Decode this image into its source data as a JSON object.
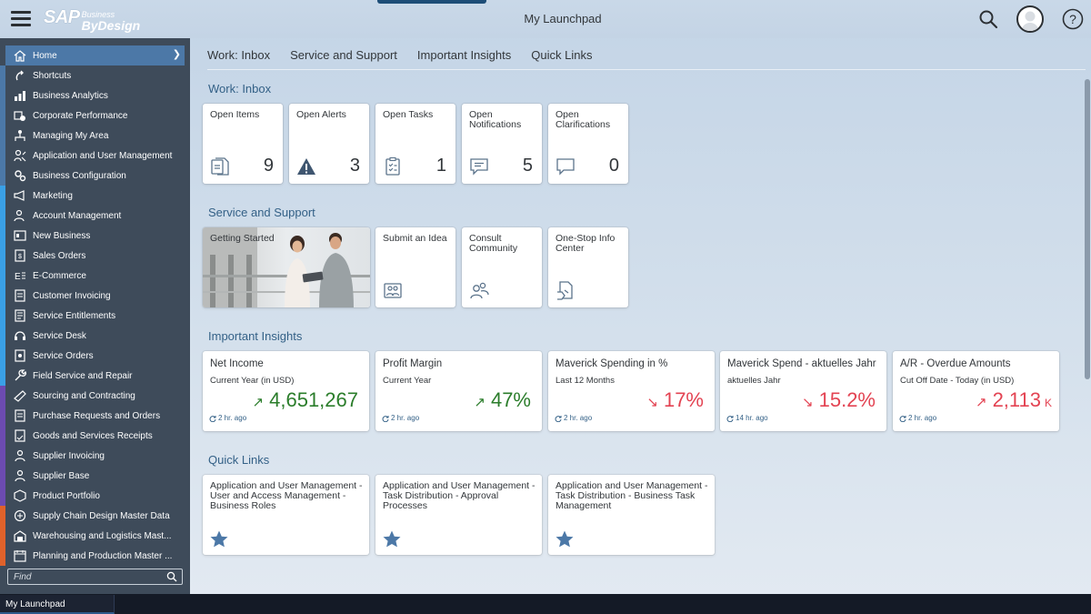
{
  "shell": {
    "brand": "SAP",
    "brand_sub_top": "Business",
    "brand_sub_bottom": "ByDesign",
    "title": "My Launchpad"
  },
  "sidebar": {
    "items": [
      {
        "label": "Home",
        "icon": "home-icon",
        "bar": "#4c78a7",
        "active": true
      },
      {
        "label": "Shortcuts",
        "icon": "shortcut-icon",
        "bar": "#4c78a7"
      },
      {
        "label": "Business Analytics",
        "icon": "bar-chart-icon",
        "bar": "#4c78a7"
      },
      {
        "label": "Corporate Performance",
        "icon": "performance-icon",
        "bar": "#4c78a7"
      },
      {
        "label": "Managing My Area",
        "icon": "org-icon",
        "bar": "#4c78a7"
      },
      {
        "label": "Application and User Management",
        "icon": "user-settings-icon",
        "bar": "#4c78a7"
      },
      {
        "label": "Business Configuration",
        "icon": "gears-icon",
        "bar": "#4c78a7"
      },
      {
        "label": "Marketing",
        "icon": "megaphone-icon",
        "bar": "#3aa0e6"
      },
      {
        "label": "Account Management",
        "icon": "account-icon",
        "bar": "#3aa0e6"
      },
      {
        "label": "New Business",
        "icon": "new-business-icon",
        "bar": "#3aa0e6"
      },
      {
        "label": "Sales Orders",
        "icon": "sales-order-icon",
        "bar": "#3aa0e6"
      },
      {
        "label": "E-Commerce",
        "icon": "ecommerce-icon",
        "bar": "#3aa0e6"
      },
      {
        "label": "Customer Invoicing",
        "icon": "invoice-icon",
        "bar": "#3aa0e6"
      },
      {
        "label": "Service Entitlements",
        "icon": "entitlement-icon",
        "bar": "#3aa0e6"
      },
      {
        "label": "Service Desk",
        "icon": "headset-icon",
        "bar": "#3aa0e6"
      },
      {
        "label": "Service Orders",
        "icon": "service-order-icon",
        "bar": "#3aa0e6"
      },
      {
        "label": "Field Service and Repair",
        "icon": "wrench-icon",
        "bar": "#3aa0e6"
      },
      {
        "label": "Sourcing and Contracting",
        "icon": "sourcing-icon",
        "bar": "#6c4bb1"
      },
      {
        "label": "Purchase Requests and Orders",
        "icon": "cart-icon",
        "bar": "#6c4bb1"
      },
      {
        "label": "Goods and Services Receipts",
        "icon": "receipt-icon",
        "bar": "#6c4bb1"
      },
      {
        "label": "Supplier Invoicing",
        "icon": "supplier-invoice-icon",
        "bar": "#6c4bb1"
      },
      {
        "label": "Supplier Base",
        "icon": "supplier-icon",
        "bar": "#6c4bb1"
      },
      {
        "label": "Product Portfolio",
        "icon": "product-icon",
        "bar": "#6c4bb1"
      },
      {
        "label": "Supply Chain Design Master Data",
        "icon": "supply-chain-icon",
        "bar": "#e0622b"
      },
      {
        "label": "Warehousing and Logistics Mast...",
        "icon": "warehouse-icon",
        "bar": "#e0622b"
      },
      {
        "label": "Planning and Production Master ...",
        "icon": "planning-icon",
        "bar": "#e0622b"
      }
    ],
    "find_placeholder": "Find"
  },
  "anchors": [
    "Work: Inbox",
    "Service and Support",
    "Important Insights",
    "Quick Links"
  ],
  "sections": {
    "inbox": {
      "title": "Work: Inbox",
      "tiles": [
        {
          "title": "Open Items",
          "count": "9",
          "icon": "document-icon"
        },
        {
          "title": "Open Alerts",
          "count": "3",
          "icon": "alert-icon"
        },
        {
          "title": "Open Tasks",
          "count": "1",
          "icon": "task-icon"
        },
        {
          "title": "Open Notifications",
          "count": "5",
          "icon": "notification-icon"
        },
        {
          "title": "Open Clarifications",
          "count": "0",
          "icon": "clarification-icon"
        }
      ]
    },
    "service": {
      "title": "Service and Support",
      "tiles": [
        {
          "title": "Getting Started",
          "icon": "photo"
        },
        {
          "title": "Submit an Idea",
          "icon": "idea-icon"
        },
        {
          "title": "Consult Community",
          "icon": "community-icon"
        },
        {
          "title": "One-Stop Info Center",
          "icon": "info-center-icon"
        }
      ]
    },
    "insights": {
      "title": "Important Insights",
      "tiles": [
        {
          "title": "Net Income",
          "subtitle": "Current Year (in USD)",
          "value": "4,651,267",
          "unit": "",
          "trend": "up",
          "status": "good",
          "refresh": "2 hr. ago"
        },
        {
          "title": "Profit Margin",
          "subtitle": "Current Year",
          "value": "47%",
          "unit": "",
          "trend": "up",
          "status": "good",
          "refresh": "2 hr. ago"
        },
        {
          "title": "Maverick Spending in %",
          "subtitle": "Last 12 Months",
          "value": "17%",
          "unit": "",
          "trend": "down",
          "status": "bad",
          "refresh": "2 hr. ago"
        },
        {
          "title": "Maverick Spend - aktuelles Jahr",
          "subtitle": "aktuelles Jahr",
          "value": "15.2%",
          "unit": "",
          "trend": "down",
          "status": "bad",
          "refresh": "14 hr. ago"
        },
        {
          "title": "A/R - Overdue Amounts",
          "subtitle": "Cut Off Date - Today (in USD)",
          "value": "2,113",
          "unit": "K",
          "trend": "up",
          "status": "bad",
          "refresh": "2 hr. ago"
        }
      ]
    },
    "quicklinks": {
      "title": "Quick Links",
      "tiles": [
        {
          "title": "Application and User Management - User and Access Management - Business Roles",
          "icon": "star-icon"
        },
        {
          "title": "Application and User Management - Task Distribution - Approval Processes",
          "icon": "star-icon"
        },
        {
          "title": "Application and User Management - Task Distribution - Business Task Management",
          "icon": "star-icon"
        }
      ]
    }
  },
  "taskbar": {
    "item": "My Launchpad"
  },
  "colors": {
    "accent": "#346187",
    "good": "#2b7d2b",
    "bad": "#e34352",
    "sidebar_bg": "#3e4b5a",
    "active_item": "#4c78a7"
  }
}
